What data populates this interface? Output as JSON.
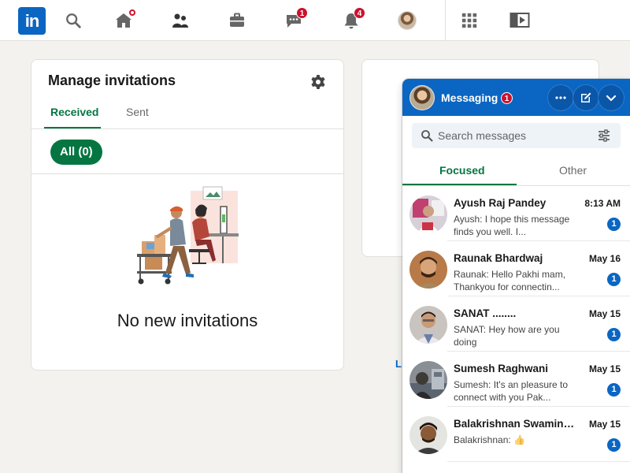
{
  "nav": {
    "logo": "in",
    "messaging_badge": "1",
    "notifications_badge": "4"
  },
  "invitations": {
    "title": "Manage invitations",
    "tabs": [
      {
        "label": "Received",
        "active": true
      },
      {
        "label": "Sent",
        "active": false
      }
    ],
    "filter_pill": "All (0)",
    "empty_text": "No new invitations"
  },
  "right_card": {
    "partial_link": "Li"
  },
  "messaging": {
    "title": "Messaging",
    "badge": "1",
    "search_placeholder": "Search messages",
    "tabs": [
      {
        "label": "Focused",
        "active": true
      },
      {
        "label": "Other",
        "active": false
      }
    ],
    "conversations": [
      {
        "name": "Ayush Raj Pandey",
        "date": "8:13 AM",
        "snippet": "Ayush: I hope this message finds you well. I...",
        "unread": "1"
      },
      {
        "name": "Raunak Bhardwaj",
        "date": "May 16",
        "snippet": "Raunak: Hello Pakhi mam, Thankyou for connectin...",
        "unread": "1"
      },
      {
        "name": "SANAT ........",
        "date": "May 15",
        "snippet": "SANAT: Hey how are you doing",
        "unread": "1"
      },
      {
        "name": "Sumesh Raghwani",
        "date": "May 15",
        "snippet": "Sumesh: It's an pleasure to connect with you Pak...",
        "unread": "1"
      },
      {
        "name": "Balakrishnan Swaminat...",
        "date": "May 15",
        "snippet": "Balakrishnan: 👍",
        "unread": "1"
      }
    ]
  },
  "colors": {
    "brand_blue": "#0a66c2",
    "accent_green": "#057642",
    "badge_red": "#cb112d",
    "page_bg": "#f3f2ef"
  }
}
